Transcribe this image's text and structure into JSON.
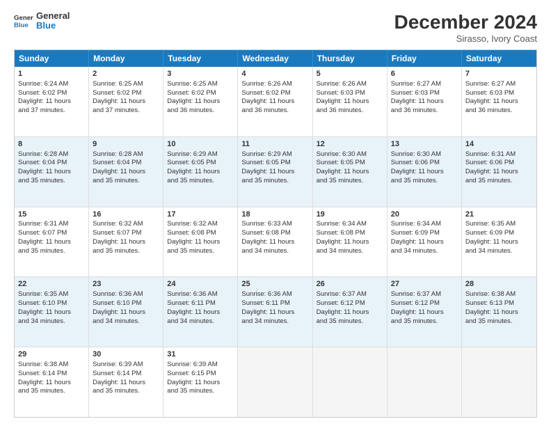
{
  "logo": {
    "line1": "General",
    "line2": "Blue"
  },
  "title": "December 2024",
  "subtitle": "Sirasso, Ivory Coast",
  "header_days": [
    "Sunday",
    "Monday",
    "Tuesday",
    "Wednesday",
    "Thursday",
    "Friday",
    "Saturday"
  ],
  "weeks": [
    [
      {
        "day": "1",
        "lines": [
          "Sunrise: 6:24 AM",
          "Sunset: 6:02 PM",
          "Daylight: 11 hours",
          "and 37 minutes."
        ]
      },
      {
        "day": "2",
        "lines": [
          "Sunrise: 6:25 AM",
          "Sunset: 6:02 PM",
          "Daylight: 11 hours",
          "and 37 minutes."
        ]
      },
      {
        "day": "3",
        "lines": [
          "Sunrise: 6:25 AM",
          "Sunset: 6:02 PM",
          "Daylight: 11 hours",
          "and 36 minutes."
        ]
      },
      {
        "day": "4",
        "lines": [
          "Sunrise: 6:26 AM",
          "Sunset: 6:02 PM",
          "Daylight: 11 hours",
          "and 36 minutes."
        ]
      },
      {
        "day": "5",
        "lines": [
          "Sunrise: 6:26 AM",
          "Sunset: 6:03 PM",
          "Daylight: 11 hours",
          "and 36 minutes."
        ]
      },
      {
        "day": "6",
        "lines": [
          "Sunrise: 6:27 AM",
          "Sunset: 6:03 PM",
          "Daylight: 11 hours",
          "and 36 minutes."
        ]
      },
      {
        "day": "7",
        "lines": [
          "Sunrise: 6:27 AM",
          "Sunset: 6:03 PM",
          "Daylight: 11 hours",
          "and 36 minutes."
        ]
      }
    ],
    [
      {
        "day": "8",
        "lines": [
          "Sunrise: 6:28 AM",
          "Sunset: 6:04 PM",
          "Daylight: 11 hours",
          "and 35 minutes."
        ]
      },
      {
        "day": "9",
        "lines": [
          "Sunrise: 6:28 AM",
          "Sunset: 6:04 PM",
          "Daylight: 11 hours",
          "and 35 minutes."
        ]
      },
      {
        "day": "10",
        "lines": [
          "Sunrise: 6:29 AM",
          "Sunset: 6:05 PM",
          "Daylight: 11 hours",
          "and 35 minutes."
        ]
      },
      {
        "day": "11",
        "lines": [
          "Sunrise: 6:29 AM",
          "Sunset: 6:05 PM",
          "Daylight: 11 hours",
          "and 35 minutes."
        ]
      },
      {
        "day": "12",
        "lines": [
          "Sunrise: 6:30 AM",
          "Sunset: 6:05 PM",
          "Daylight: 11 hours",
          "and 35 minutes."
        ]
      },
      {
        "day": "13",
        "lines": [
          "Sunrise: 6:30 AM",
          "Sunset: 6:06 PM",
          "Daylight: 11 hours",
          "and 35 minutes."
        ]
      },
      {
        "day": "14",
        "lines": [
          "Sunrise: 6:31 AM",
          "Sunset: 6:06 PM",
          "Daylight: 11 hours",
          "and 35 minutes."
        ]
      }
    ],
    [
      {
        "day": "15",
        "lines": [
          "Sunrise: 6:31 AM",
          "Sunset: 6:07 PM",
          "Daylight: 11 hours",
          "and 35 minutes."
        ]
      },
      {
        "day": "16",
        "lines": [
          "Sunrise: 6:32 AM",
          "Sunset: 6:07 PM",
          "Daylight: 11 hours",
          "and 35 minutes."
        ]
      },
      {
        "day": "17",
        "lines": [
          "Sunrise: 6:32 AM",
          "Sunset: 6:08 PM",
          "Daylight: 11 hours",
          "and 35 minutes."
        ]
      },
      {
        "day": "18",
        "lines": [
          "Sunrise: 6:33 AM",
          "Sunset: 6:08 PM",
          "Daylight: 11 hours",
          "and 34 minutes."
        ]
      },
      {
        "day": "19",
        "lines": [
          "Sunrise: 6:34 AM",
          "Sunset: 6:08 PM",
          "Daylight: 11 hours",
          "and 34 minutes."
        ]
      },
      {
        "day": "20",
        "lines": [
          "Sunrise: 6:34 AM",
          "Sunset: 6:09 PM",
          "Daylight: 11 hours",
          "and 34 minutes."
        ]
      },
      {
        "day": "21",
        "lines": [
          "Sunrise: 6:35 AM",
          "Sunset: 6:09 PM",
          "Daylight: 11 hours",
          "and 34 minutes."
        ]
      }
    ],
    [
      {
        "day": "22",
        "lines": [
          "Sunrise: 6:35 AM",
          "Sunset: 6:10 PM",
          "Daylight: 11 hours",
          "and 34 minutes."
        ]
      },
      {
        "day": "23",
        "lines": [
          "Sunrise: 6:36 AM",
          "Sunset: 6:10 PM",
          "Daylight: 11 hours",
          "and 34 minutes."
        ]
      },
      {
        "day": "24",
        "lines": [
          "Sunrise: 6:36 AM",
          "Sunset: 6:11 PM",
          "Daylight: 11 hours",
          "and 34 minutes."
        ]
      },
      {
        "day": "25",
        "lines": [
          "Sunrise: 6:36 AM",
          "Sunset: 6:11 PM",
          "Daylight: 11 hours",
          "and 34 minutes."
        ]
      },
      {
        "day": "26",
        "lines": [
          "Sunrise: 6:37 AM",
          "Sunset: 6:12 PM",
          "Daylight: 11 hours",
          "and 35 minutes."
        ]
      },
      {
        "day": "27",
        "lines": [
          "Sunrise: 6:37 AM",
          "Sunset: 6:12 PM",
          "Daylight: 11 hours",
          "and 35 minutes."
        ]
      },
      {
        "day": "28",
        "lines": [
          "Sunrise: 6:38 AM",
          "Sunset: 6:13 PM",
          "Daylight: 11 hours",
          "and 35 minutes."
        ]
      }
    ],
    [
      {
        "day": "29",
        "lines": [
          "Sunrise: 6:38 AM",
          "Sunset: 6:14 PM",
          "Daylight: 11 hours",
          "and 35 minutes."
        ]
      },
      {
        "day": "30",
        "lines": [
          "Sunrise: 6:39 AM",
          "Sunset: 6:14 PM",
          "Daylight: 11 hours",
          "and 35 minutes."
        ]
      },
      {
        "day": "31",
        "lines": [
          "Sunrise: 6:39 AM",
          "Sunset: 6:15 PM",
          "Daylight: 11 hours",
          "and 35 minutes."
        ]
      },
      null,
      null,
      null,
      null
    ]
  ]
}
